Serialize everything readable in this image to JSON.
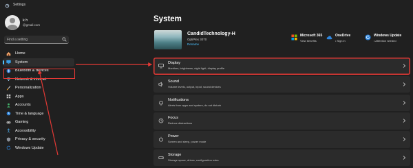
{
  "window": {
    "title": "Settings"
  },
  "user": {
    "name": "k h",
    "email": "@gmail.com"
  },
  "search": {
    "placeholder": "Find a setting"
  },
  "sidebar": {
    "items": [
      {
        "label": "Home",
        "icon": "home-icon"
      },
      {
        "label": "System",
        "icon": "monitor-icon",
        "active": true
      },
      {
        "label": "Bluetooth & devices",
        "icon": "bluetooth-icon"
      },
      {
        "label": "Network & internet",
        "icon": "wifi-icon"
      },
      {
        "label": "Personalization",
        "icon": "brush-icon"
      },
      {
        "label": "Apps",
        "icon": "apps-icon"
      },
      {
        "label": "Accounts",
        "icon": "person-icon"
      },
      {
        "label": "Time & language",
        "icon": "globe-clock-icon"
      },
      {
        "label": "Gaming",
        "icon": "gamepad-icon"
      },
      {
        "label": "Accessibility",
        "icon": "accessibility-icon"
      },
      {
        "label": "Privacy & security",
        "icon": "shield-icon"
      },
      {
        "label": "Windows Update",
        "icon": "update-icon"
      }
    ]
  },
  "main": {
    "title": "System",
    "device": {
      "name": "CandidTechnology-H",
      "model": "OptiPlex 3070",
      "rename": "Rename"
    },
    "quick": [
      {
        "title": "Microsoft 365",
        "subtitle": "View benefits",
        "icon": "microsoft-logo-icon"
      },
      {
        "title": "OneDrive",
        "subtitle": "• Sign in",
        "icon": "cloud-icon"
      },
      {
        "title": "Windows Update",
        "subtitle": "• Attention needed",
        "icon": "update-icon"
      }
    ],
    "settings": [
      {
        "title": "Display",
        "subtitle": "Monitors, brightness, night light, display profile",
        "icon": "display-icon",
        "highlighted": true
      },
      {
        "title": "Sound",
        "subtitle": "Volume levels, output, input, sound devices",
        "icon": "speaker-icon"
      },
      {
        "title": "Notifications",
        "subtitle": "Alerts from apps and system, do not disturb",
        "icon": "bell-icon"
      },
      {
        "title": "Focus",
        "subtitle": "Reduce distractions",
        "icon": "focus-icon"
      },
      {
        "title": "Power",
        "subtitle": "Screen and sleep, power mode",
        "icon": "power-icon"
      },
      {
        "title": "Storage",
        "subtitle": "Storage space, drives, configuration rules",
        "icon": "storage-icon"
      }
    ]
  },
  "colors": {
    "background": "#202020",
    "card": "#2b2b2b",
    "accent": "#4cc2ff",
    "annotation": "#e53935"
  }
}
